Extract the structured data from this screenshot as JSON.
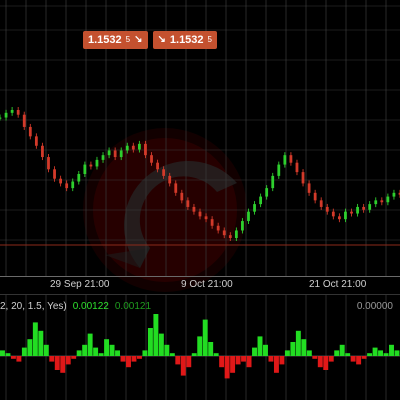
{
  "toolbar": {
    "sell_price": "1.1532",
    "sell_suffix": "5",
    "buy_price": "1.1532",
    "buy_suffix": "5"
  },
  "colors": {
    "background": "#000000",
    "grid": "#3a3a3a",
    "candle_up": "#2ecf2e",
    "candle_down": "#d23a2a",
    "hist_up": "#22dd22",
    "hist_down": "#e01818",
    "price_line": "#8b2a1a",
    "button": "#c4512f"
  },
  "chart_data": [
    {
      "type": "line",
      "title": "",
      "x_tick_labels": [
        "29 Sep 21:00",
        "9 Oct 21:00",
        "21 Oct 21:00"
      ],
      "grid": true,
      "series": [
        {
          "values": [
            1.164,
            1.1645,
            1.1648,
            1.1643,
            1.163,
            1.162,
            1.161,
            1.1598,
            1.1585,
            1.1575,
            1.157,
            1.1565,
            1.1572,
            1.158,
            1.159,
            1.1588,
            1.1595,
            1.16,
            1.1605,
            1.1598,
            1.1605,
            1.161,
            1.1606,
            1.1612,
            1.16,
            1.1592,
            1.1585,
            1.1578,
            1.157,
            1.156,
            1.1552,
            1.1545,
            1.154,
            1.1535,
            1.1532,
            1.1525,
            1.152,
            1.1515,
            1.1512,
            1.152,
            1.153,
            1.154,
            1.1548,
            1.1556,
            1.1565,
            1.1578,
            1.159,
            1.16,
            1.1592,
            1.1582,
            1.157,
            1.156,
            1.1552,
            1.1545,
            1.154,
            1.1535,
            1.1532,
            1.154,
            1.1538,
            1.1545,
            1.1542,
            1.1548,
            1.1552,
            1.155,
            1.1556,
            1.156,
            1.1558
          ]
        }
      ]
    },
    {
      "type": "bar",
      "title": "",
      "indicator_label": "2, 20, 1.5, Yes)",
      "readouts": [
        "0.00122",
        "0.00121",
        "0.00000"
      ],
      "series": [
        {
          "values": [
            0.0002,
            0.0001,
            -0.0001,
            -0.0002,
            0.0003,
            0.0006,
            0.0012,
            0.0009,
            0.0004,
            -0.0002,
            -0.0005,
            -0.0006,
            -0.0003,
            -0.0001,
            0.0002,
            0.0004,
            0.0008,
            0.0003,
            0.0001,
            0.0006,
            0.0004,
            0.0002,
            -0.0002,
            -0.0004,
            -0.0002,
            -0.0001,
            0.0002,
            0.001,
            0.0015,
            0.0008,
            0.0004,
            0.0001,
            -0.0003,
            -0.0007,
            -0.0004,
            0.0001,
            0.0007,
            0.0013,
            0.0005,
            0.0001,
            -0.0004,
            -0.0008,
            -0.0006,
            -0.0003,
            -0.0002,
            -0.0004,
            0.0003,
            0.0007,
            0.0004,
            -0.0002,
            -0.0006,
            -0.0003,
            0.0002,
            0.0005,
            0.0009,
            0.0006,
            0.0002,
            -0.0001,
            -0.0004,
            -0.0005,
            -0.0002,
            0.0002,
            0.0004,
            0.0001,
            -0.0002,
            -0.0003,
            -0.0001,
            0.0001,
            0.0003,
            0.0002,
            0.0001,
            0.0004,
            0.0002
          ]
        }
      ]
    }
  ]
}
